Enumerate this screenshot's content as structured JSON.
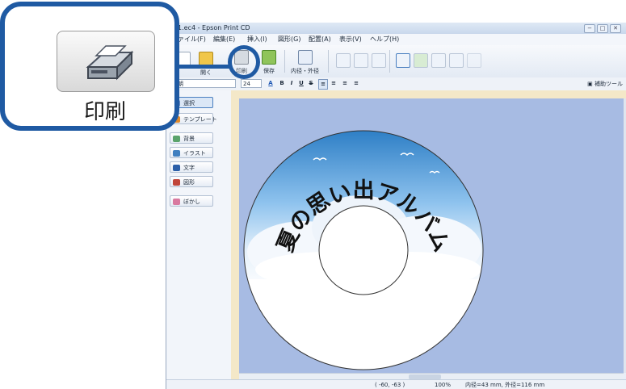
{
  "window": {
    "title": "1.ec4 - Epson Print CD",
    "buttons": [
      "−",
      "□",
      "✕"
    ]
  },
  "menu": {
    "items": [
      "ファイル(F)",
      "編集(E)",
      "挿入(I)",
      "図形(G)",
      "配置(A)",
      "表示(V)",
      "ヘルプ(H)"
    ]
  },
  "toolbar": {
    "items": [
      {
        "label": "",
        "icon": "new-icon"
      },
      {
        "label": "開く",
        "icon": "open-icon"
      },
      {
        "label": "印刷",
        "icon": "printer-icon"
      },
      {
        "label": "保存",
        "icon": "save-icon"
      },
      {
        "label": "内径・外径",
        "icon": "diameter-icon"
      }
    ]
  },
  "format_bar": {
    "font": "明朝",
    "size": "24",
    "assist_tool": "補助ツール"
  },
  "left_panel": {
    "items": [
      {
        "label": "選択",
        "icon": "select-icon"
      },
      {
        "label": "テンプレート",
        "icon": "template-icon"
      },
      {
        "label": "背景",
        "icon": "background-icon"
      },
      {
        "label": "イラスト",
        "icon": "illustration-icon"
      },
      {
        "label": "文字",
        "icon": "text-icon"
      },
      {
        "label": "図形",
        "icon": "shape-icon"
      },
      {
        "label": "ぼかし",
        "icon": "blur-icon"
      }
    ]
  },
  "canvas": {
    "disc_text": "夏の思い出アルバム"
  },
  "status": {
    "coords": "( -60, -63 )",
    "zoom": "100%",
    "diameter": "内径=43 mm, 外径=116 mm"
  },
  "callout": {
    "label": "印刷"
  },
  "colors": {
    "callout_border": "#1f5aa3",
    "canvas_bg": "#a7bbe3",
    "sky_top": "#2e7fc6"
  }
}
